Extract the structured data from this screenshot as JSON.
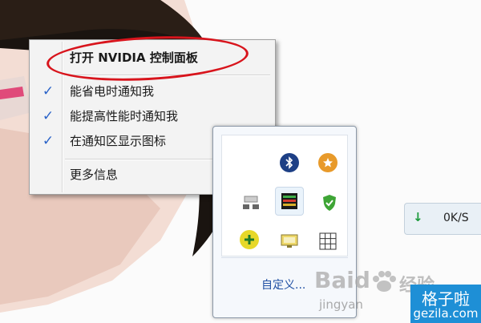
{
  "context_menu": {
    "items": [
      {
        "label": "打开 NVIDIA 控制面板",
        "checked": false,
        "bold": true
      },
      {
        "label": "能省电时通知我",
        "checked": true
      },
      {
        "label": "能提高性能时通知我",
        "checked": true
      },
      {
        "label": "在通知区显示图标",
        "checked": true
      },
      {
        "label": "更多信息",
        "checked": false
      }
    ],
    "check_glyph": "✓",
    "highlight_color": "#d8141c"
  },
  "tray_panel": {
    "icons": [
      "bluetooth-icon",
      "star-badge-icon",
      "network-adapter-icon",
      "nvidia-monitor-icon",
      "security-shield-icon",
      "green-plus-icon",
      "display-icon",
      "grid-icon"
    ],
    "customize_label": "自定义..."
  },
  "speed_widget": {
    "arrow": "↓",
    "value": "0K/S"
  },
  "watermark": {
    "logo_text": "Baid",
    "logo_suffix": "经验",
    "sub_text": "jingyan",
    "brand_cn": "格子啦",
    "brand_en": "gezila.com"
  }
}
